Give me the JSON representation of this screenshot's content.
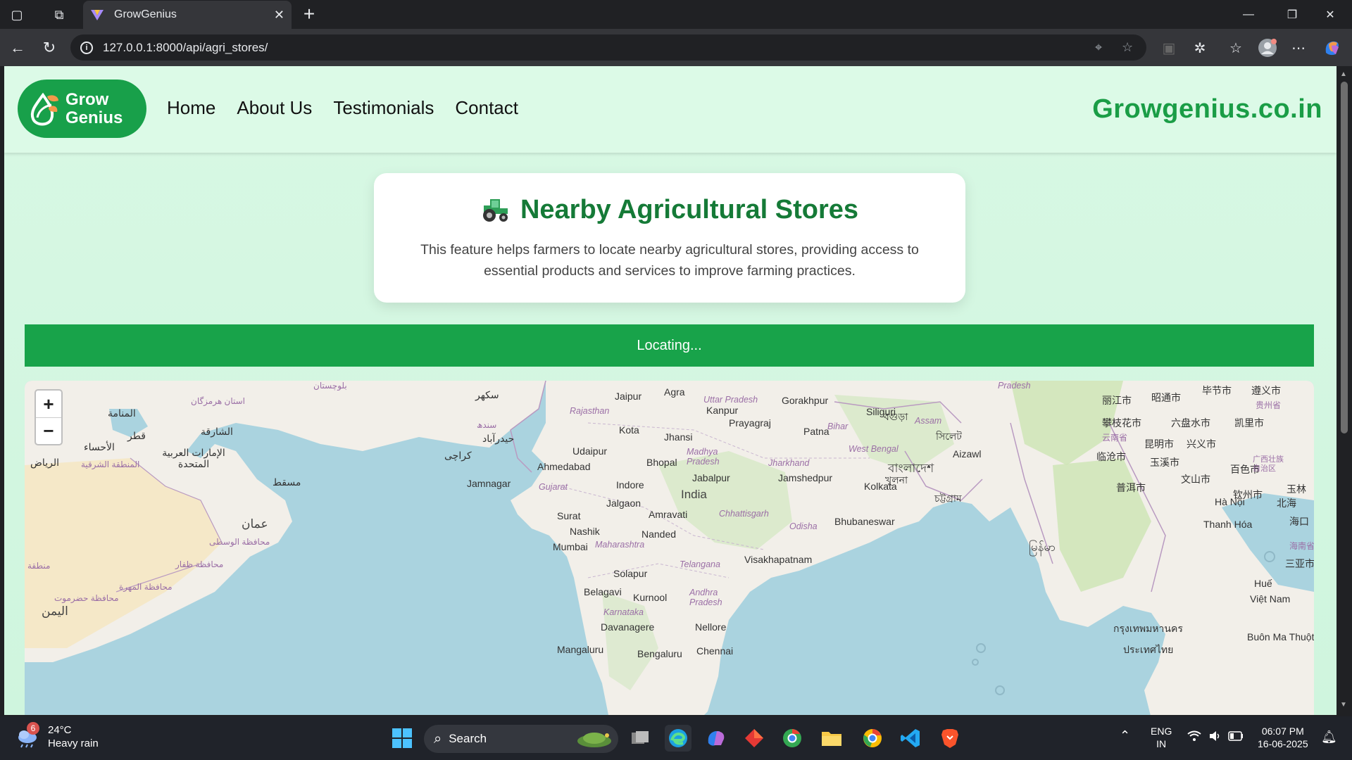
{
  "browser": {
    "tab_title": "GrowGenius",
    "tab_close": "✕",
    "new_tab": "+",
    "url": "127.0.0.1:8000/api/agri_stores/",
    "window_controls": {
      "minimize": "—",
      "maximize": "❐",
      "close": "✕"
    }
  },
  "site": {
    "logo": {
      "line1": "Grow",
      "line2": "Genius"
    },
    "nav": [
      "Home",
      "About Us",
      "Testimonials",
      "Contact"
    ],
    "domain": "Growgenius.co.in"
  },
  "hero": {
    "icon": "tractor-icon",
    "title": "Nearby Agricultural Stores",
    "description": "This feature helps farmers to locate nearby agricultural stores, providing access to essential products and services to improve farming practices."
  },
  "status": {
    "text": "Locating..."
  },
  "map": {
    "zoom_in": "+",
    "zoom_out": "−",
    "labels": {
      "cities": [
        "Jaipur",
        "Agra",
        "Kanpur",
        "Gorakhpur",
        "Siliguri",
        "Kota",
        "Prayagraj",
        "Patna",
        "Jhansi",
        "Udaipur",
        "Bhopal",
        "Ahmedabad",
        "Jabalpur",
        "Jamshedpur",
        "Aizawl",
        "Indore",
        "Jamnagar",
        "Kolkata",
        "India",
        "Jalgaon",
        "Amravati",
        "Surat",
        "Bhubaneswar",
        "Nashik",
        "Nanded",
        "Mumbai",
        "Visakhapatnam",
        "Solapur",
        "Belagavi",
        "Kurnool",
        "Davanagere",
        "Nellore",
        "Mangaluru",
        "Bengaluru",
        "Chennai",
        "Hà Nội",
        "Thanh Hóa",
        "Huế",
        "Việt Nam",
        "Buôn Ma Thuột"
      ],
      "states": [
        "Rajasthan",
        "Uttar Pradesh",
        "Bihar",
        "Assam",
        "Madhya Pradesh",
        "Jharkhand",
        "West Bengal",
        "Gujarat",
        "Chhattisgarh",
        "Odisha",
        "Maharashtra",
        "Telangana",
        "Andhra Pradesh",
        "Karnataka",
        "Pradesh"
      ],
      "foreign": [
        "المنامة",
        "قطر",
        "الأحساء",
        "الرياض",
        "الشارقة",
        "الإمارات العربية المتحدة",
        "المنطقة الشرقية",
        "مسقط",
        "عمان",
        "محافظة الوسطى",
        "محافظة ظفار",
        "محافظة المهرة",
        "محافظة حضرموت",
        "اليمن",
        "منطقة",
        "استان هرمزگان",
        "بلوچستان",
        "سکھر",
        "سندھ",
        "حیدرآباد",
        "کراچی",
        "丽江市",
        "昭通市",
        "毕节市",
        "遵义市",
        "贵州省",
        "攀枝花市",
        "六盘水市",
        "凯里市",
        "云南省",
        "昆明市",
        "兴义市",
        "临沧市",
        "玉溪市",
        "文山市",
        "百色市",
        "广西壮族自治区",
        "普洱市",
        "钦州市",
        "北海",
        "玉林",
        "海口",
        "海南省",
        "三亚市",
        "বাংলাদেশ",
        "খুলনা",
        "চট্টগ্রাম",
        "সিলেট",
        "বগুড়া",
        "မြန်မာ",
        "ประเทศไทย",
        "กรุงเทพมหานคร"
      ]
    }
  },
  "taskbar": {
    "weather": {
      "temp": "24°C",
      "condition": "Heavy rain",
      "badge": "6"
    },
    "search": "Search",
    "lang": {
      "line1": "ENG",
      "line2": "IN"
    },
    "time": "06:07 PM",
    "date": "16-06-2025"
  },
  "colors": {
    "brand_green": "#18a04a",
    "title_green": "#157a37",
    "page_bg": "#d8f8e4"
  }
}
